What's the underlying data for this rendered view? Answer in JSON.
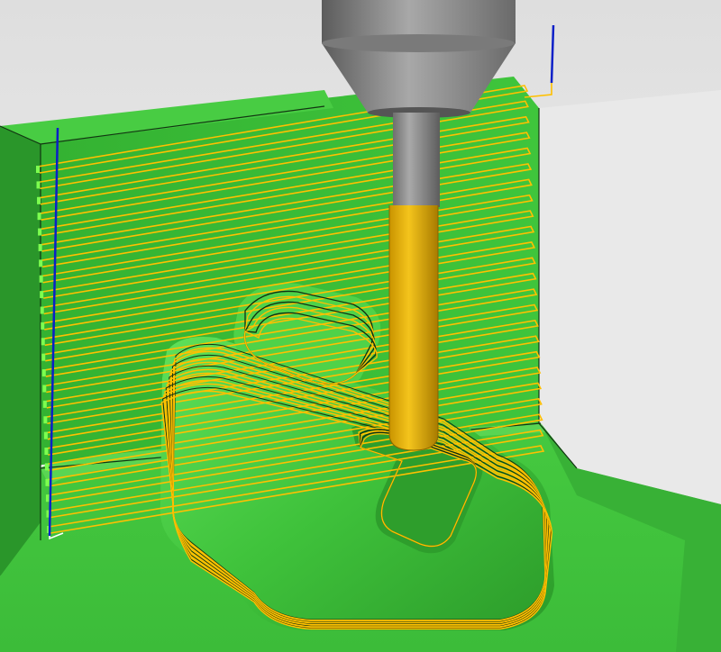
{
  "viewport": {
    "view": "3d-cam-toolpath-simulation",
    "background_top": "#dedede",
    "background_bottom": "#f6f6f6"
  },
  "colors": {
    "part_face_top": "#3fc13c",
    "part_face_highlight": "#5fda55",
    "part_face_front": "#2f9e2f",
    "part_face_back_wall": "#3aba38",
    "part_face_left": "#34a932",
    "edge_line": "#103010",
    "toolpath": "#ffc000",
    "tool_shank": "#8f8f8f",
    "tool_holder": "#9a9a9a",
    "tool_flute": "#e5b300",
    "axis_blue": "#0b1fc7",
    "endpoint_green": "#7dff4f"
  },
  "icons": {
    "tool": "ball-end-mill-icon",
    "stock": "workpiece-block-icon",
    "axis": "tool-axis-icon"
  },
  "toolpath": {
    "pass_count": 24,
    "boss_contour_count": 14,
    "strategy": "zlevel"
  }
}
